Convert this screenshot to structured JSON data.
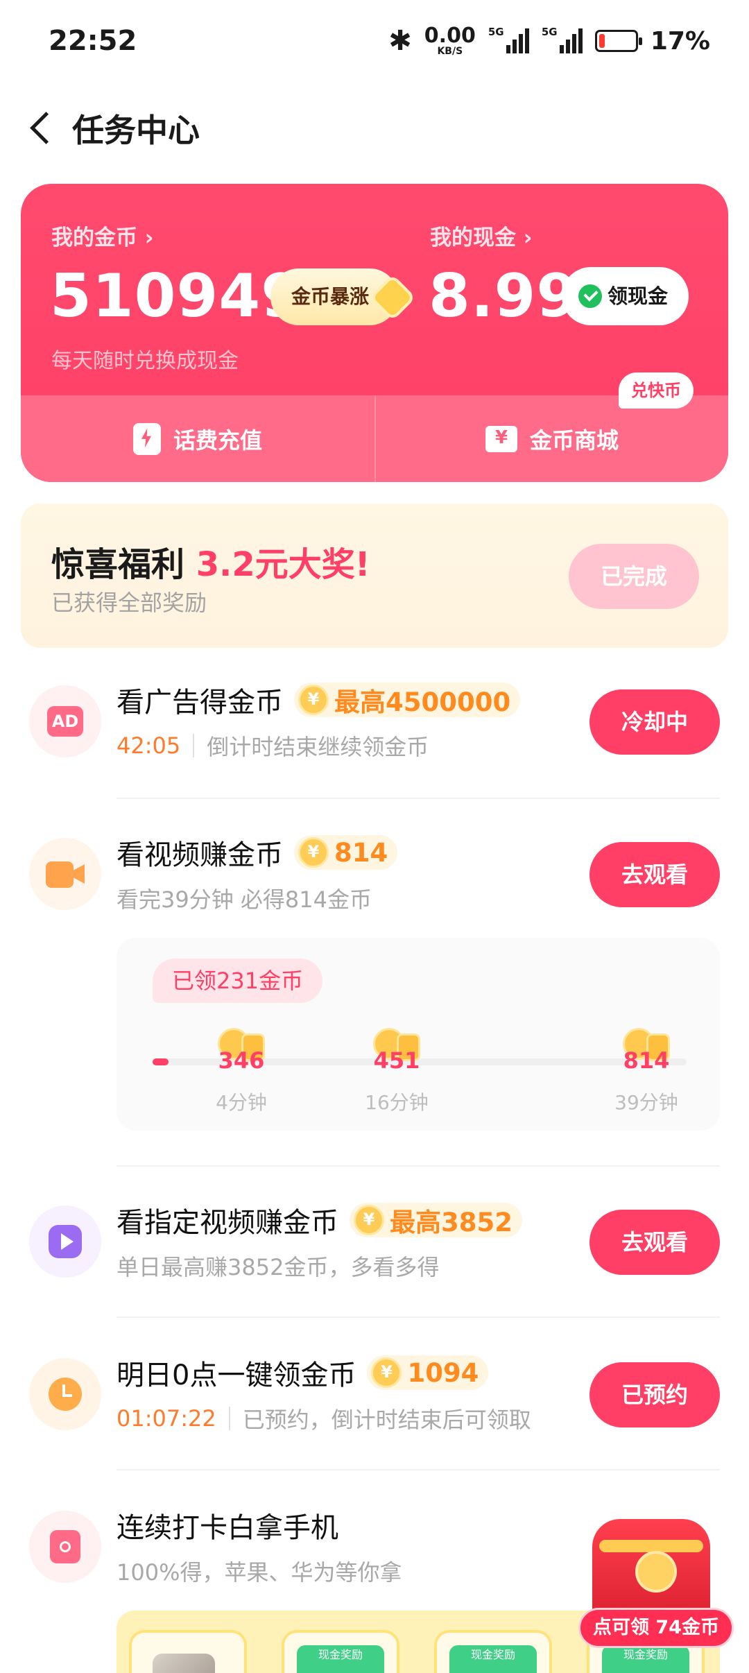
{
  "status_bar": {
    "time": "22:52",
    "net_speed": "0.00",
    "net_unit": "KB/S",
    "signal_label_1": "5G",
    "signal_label_2": "5G",
    "battery": "17%",
    "battery_level": 0.17
  },
  "header": {
    "title": "任务中心"
  },
  "wallet": {
    "coins_label": "我的金币 ›",
    "coins_value": "510949",
    "coins_pill": "金币暴涨",
    "cash_label": "我的现金 ›",
    "cash_value": "8.99",
    "cash_pill": "领现金",
    "subtitle": "每天随时兑换成现金",
    "recharge": "话费充值",
    "mall": "金币商城",
    "mall_badge": "兑快币"
  },
  "surprise": {
    "title_prefix": "惊喜福利 ",
    "title_highlight": "3.2元大奖!",
    "subtitle": "已获得全部奖励",
    "button": "已完成"
  },
  "tasks": [
    {
      "title": "看广告得金币",
      "reward": "最高4500000",
      "countdown": "42:05",
      "desc": "倒计时结束继续领金币",
      "button": "冷却中",
      "icon": "ad-icon"
    },
    {
      "title": "看视频赚金币",
      "reward": "814",
      "desc": "看完39分钟 必得814金币",
      "button": "去观看",
      "icon": "video-camera-icon"
    },
    {
      "title": "看指定视频赚金币",
      "reward": "最高3852",
      "desc": "单日最高赚3852金币，多看多得",
      "button": "去观看",
      "icon": "play-icon"
    },
    {
      "title": "明日0点一键领金币",
      "reward": "1094",
      "countdown": "01:07:22",
      "desc": "已预约，倒计时结束后可领取",
      "button": "已预约",
      "icon": "clock-icon"
    },
    {
      "title": "连续打卡白拿手机",
      "desc": "100%得，苹果、华为等你拿",
      "icon": "phone-box-icon"
    }
  ],
  "video_progress": {
    "earned": "已领231金币",
    "fill_fraction": 0.03,
    "milestones": [
      {
        "value": "346",
        "time": "4分钟"
      },
      {
        "value": "451",
        "time": "16分钟"
      },
      {
        "value": "814",
        "time": "39分钟"
      }
    ]
  },
  "checkin_strip": {
    "cash_label_1": "现金奖励",
    "cash_label_2": "现金奖励",
    "cash_label_3": "现金奖励"
  },
  "floating": {
    "label": "点可领 74金币"
  },
  "colors": {
    "primary": "#ff3f66",
    "orange": "#ff8a1e",
    "gold": "#ffcc55"
  }
}
